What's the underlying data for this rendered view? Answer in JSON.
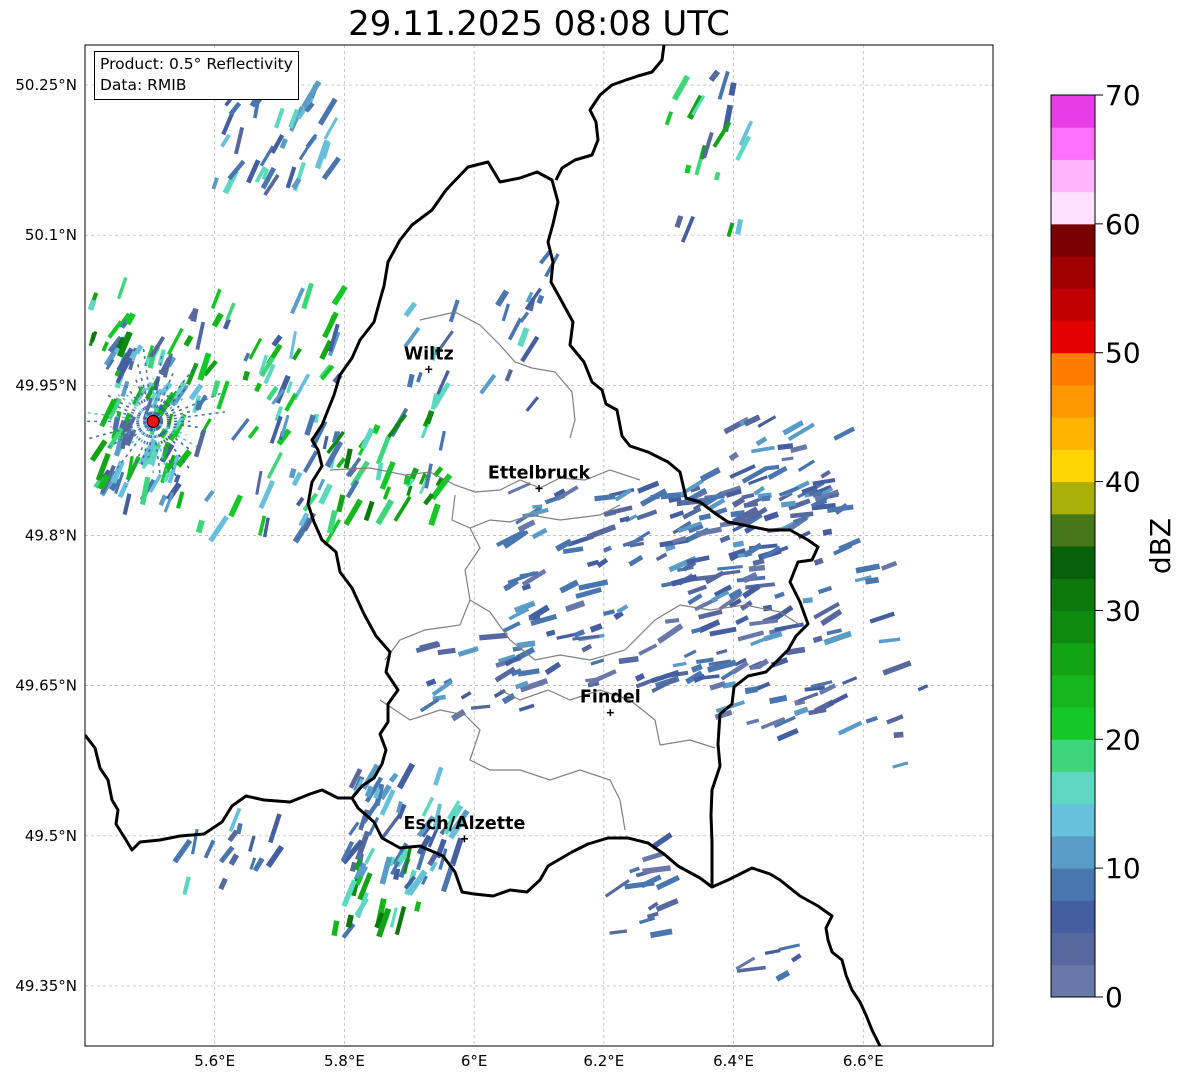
{
  "title": "29.11.2025 08:08 UTC",
  "info": {
    "product": "Product: 0.5° Reflectivity",
    "data": "Data: RMIB"
  },
  "map": {
    "lon_range": [
      5.4,
      6.8
    ],
    "lat_range": [
      49.29,
      50.29
    ],
    "x_ticks": [
      {
        "value": 5.6,
        "label": "5.6°E"
      },
      {
        "value": 5.8,
        "label": "5.8°E"
      },
      {
        "value": 6.0,
        "label": "6°E"
      },
      {
        "value": 6.2,
        "label": "6.2°E"
      },
      {
        "value": 6.4,
        "label": "6.4°E"
      },
      {
        "value": 6.6,
        "label": "6.6°E"
      }
    ],
    "y_ticks": [
      {
        "value": 49.35,
        "label": "49.35°N"
      },
      {
        "value": 49.5,
        "label": "49.5°N"
      },
      {
        "value": 49.65,
        "label": "49.65°N"
      },
      {
        "value": 49.8,
        "label": "49.8°N"
      },
      {
        "value": 49.95,
        "label": "49.95°N"
      },
      {
        "value": 50.1,
        "label": "50.1°N"
      },
      {
        "value": 50.25,
        "label": "50.25°N"
      }
    ],
    "cities": [
      {
        "name": "Wiltz",
        "lon": 5.93,
        "lat": 49.966
      },
      {
        "name": "Ettelbruck",
        "lon": 6.1,
        "lat": 49.847
      },
      {
        "name": "Findel",
        "lon": 6.21,
        "lat": 49.623
      },
      {
        "name": "Esch/Alzette",
        "lon": 5.985,
        "lat": 49.497
      }
    ],
    "radar_site": {
      "lon": 5.505,
      "lat": 49.914,
      "color": "#e8141e"
    },
    "border_color": "#000000",
    "district_color": "#808080",
    "grid_color": "#b0b0b0"
  },
  "colorbar": {
    "label": "dBZ",
    "min": 0,
    "max": 70,
    "step": 2.5,
    "ticks": [
      "0",
      "10",
      "20",
      "30",
      "40",
      "50",
      "60",
      "70"
    ],
    "colors": [
      "#6878a8",
      "#56689e",
      "#445ea0",
      "#4a76b0",
      "#5a9cc8",
      "#66c0dc",
      "#5ed8c0",
      "#3ed67a",
      "#14c828",
      "#14b81a",
      "#12a414",
      "#0e8a10",
      "#0c780e",
      "#08600a",
      "#46781a",
      "#aab00a",
      "#ffd400",
      "#ffb400",
      "#ff9800",
      "#ff7c00",
      "#e40000",
      "#c00000",
      "#a00000",
      "#780000",
      "#ffe0ff",
      "#ffb4ff",
      "#ff70ff",
      "#e83ce8"
    ]
  },
  "echo_regions": [
    {
      "lon": [
        5.42,
        5.55
      ],
      "lat": [
        49.83,
        50.0
      ],
      "n": 90,
      "palette": "blue-green"
    },
    {
      "lon": [
        5.55,
        5.8
      ],
      "lat": [
        49.8,
        50.05
      ],
      "n": 80,
      "palette": "blue-green"
    },
    {
      "lon": [
        5.78,
        5.96
      ],
      "lat": [
        49.82,
        49.92
      ],
      "n": 45,
      "palette": "green"
    },
    {
      "lon": [
        5.6,
        5.78
      ],
      "lat": [
        50.15,
        50.25
      ],
      "n": 40,
      "palette": "blue-teal"
    },
    {
      "lon": [
        5.4,
        5.48
      ],
      "lat": [
        49.99,
        50.05
      ],
      "n": 12,
      "palette": "green"
    },
    {
      "lon": [
        6.05,
        6.45
      ],
      "lat": [
        49.65,
        49.85
      ],
      "n": 140,
      "palette": "blue"
    },
    {
      "lon": [
        6.3,
        6.55
      ],
      "lat": [
        49.6,
        49.87
      ],
      "n": 90,
      "palette": "blue"
    },
    {
      "lon": [
        6.4,
        6.58
      ],
      "lat": [
        49.8,
        49.92
      ],
      "n": 35,
      "palette": "blue"
    },
    {
      "lon": [
        6.55,
        6.7
      ],
      "lat": [
        49.55,
        49.8
      ],
      "n": 20,
      "palette": "blue"
    },
    {
      "lon": [
        5.8,
        5.98
      ],
      "lat": [
        49.45,
        49.56
      ],
      "n": 60,
      "palette": "blue-teal"
    },
    {
      "lon": [
        5.78,
        5.92
      ],
      "lat": [
        49.4,
        49.48
      ],
      "n": 18,
      "palette": "green"
    },
    {
      "lon": [
        5.92,
        6.1
      ],
      "lat": [
        49.62,
        49.7
      ],
      "n": 20,
      "palette": "blue"
    },
    {
      "lon": [
        6.22,
        6.3
      ],
      "lat": [
        49.4,
        49.5
      ],
      "n": 15,
      "palette": "blue"
    },
    {
      "lon": [
        6.3,
        6.42
      ],
      "lat": [
        50.1,
        50.28
      ],
      "n": 20,
      "palette": "blue-green"
    },
    {
      "lon": [
        5.9,
        6.12
      ],
      "lat": [
        49.92,
        50.08
      ],
      "n": 25,
      "palette": "blue-teal"
    },
    {
      "lon": [
        5.55,
        5.75
      ],
      "lat": [
        49.45,
        49.52
      ],
      "n": 15,
      "palette": "blue-teal"
    },
    {
      "lon": [
        6.4,
        6.5
      ],
      "lat": [
        49.35,
        49.4
      ],
      "n": 6,
      "palette": "blue"
    }
  ]
}
